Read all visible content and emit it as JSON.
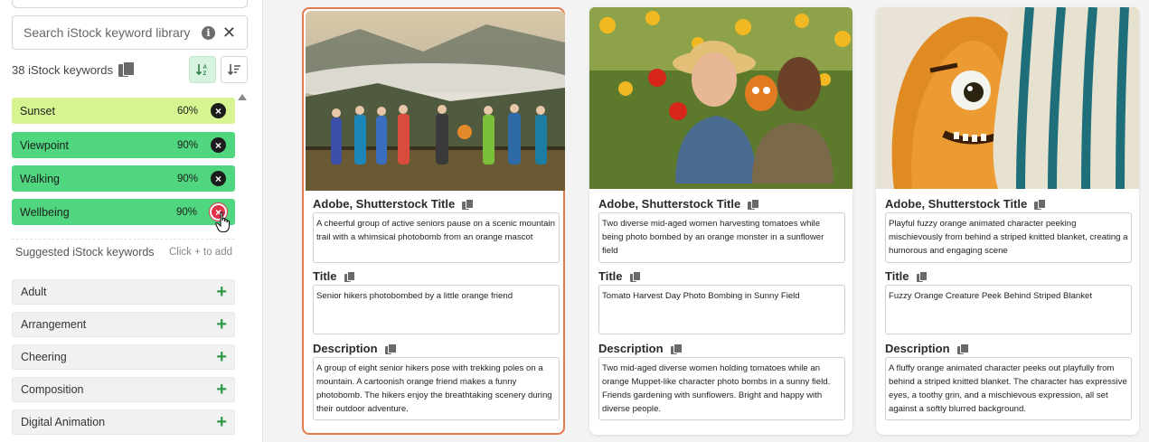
{
  "sidebar": {
    "search": {
      "placeholder": "Search iStock keyword library"
    },
    "keyword_count_label": "38 iStock keywords",
    "keywords": [
      {
        "name": "Sunset",
        "pct": "60%",
        "color": "#d6f590"
      },
      {
        "name": "Viewpoint",
        "pct": "90%",
        "color": "#4fd67f"
      },
      {
        "name": "Walking",
        "pct": "90%",
        "color": "#4fd67f"
      },
      {
        "name": "Wellbeing",
        "pct": "90%",
        "color": "#4fd67f"
      }
    ],
    "remove_glyph": "×",
    "suggested": {
      "title": "Suggested iStock keywords",
      "hint": "Click + to add",
      "items": [
        "Adult",
        "Arrangement",
        "Cheering",
        "Composition",
        "Digital Animation"
      ],
      "add_glyph": "+"
    }
  },
  "cards": [
    {
      "adobe_label": "Adobe, Shutterstock Title",
      "adobe_title": "A cheerful group of active seniors pause on a scenic mountain trail with a whimsical photobomb from an orange mascot",
      "title_label": "Title",
      "title": "Senior hikers photobombed by a little orange friend",
      "description_label": "Description",
      "description": "A group of eight senior hikers pose with trekking poles on a mountain. A cartoonish orange friend makes a funny photobomb. The hikers enjoy the breathtaking scenery during their outdoor adventure."
    },
    {
      "adobe_label": "Adobe, Shutterstock Title",
      "adobe_title": "Two diverse mid-aged women harvesting tomatoes while being photo bombed by an orange monster in a sunflower field",
      "title_label": "Title",
      "title": "Tomato Harvest Day Photo Bombing in Sunny Field",
      "description_label": "Description",
      "description": "Two mid-aged diverse women holding tomatoes while an orange Muppet-like character photo bombs in a sunny field. Friends gardening with sunflowers. Bright and happy with diverse people."
    },
    {
      "adobe_label": "Adobe, Shutterstock Title",
      "adobe_title": "Playful fuzzy orange animated character peeking mischievously from behind a striped knitted blanket, creating a humorous and engaging scene",
      "title_label": "Title",
      "title": "Fuzzy Orange Creature Peek Behind Striped Blanket",
      "description_label": "Description",
      "description": "A fluffy orange animated character peeks out playfully from behind a striped knitted blanket. The character has expressive eyes, a toothy grin, and a mischievous expression, all set against a softly blurred background."
    }
  ],
  "colors": {
    "accent_selected": "#e07b4f",
    "add_green": "#2e9a4a",
    "remove_hover": "#e0334a"
  },
  "icons": [
    "info-icon",
    "close-icon",
    "copy-icon",
    "sort-asc-icon",
    "sort-desc-icon",
    "remove-icon",
    "add-icon",
    "hand-cursor-icon",
    "scroll-up-icon"
  ]
}
